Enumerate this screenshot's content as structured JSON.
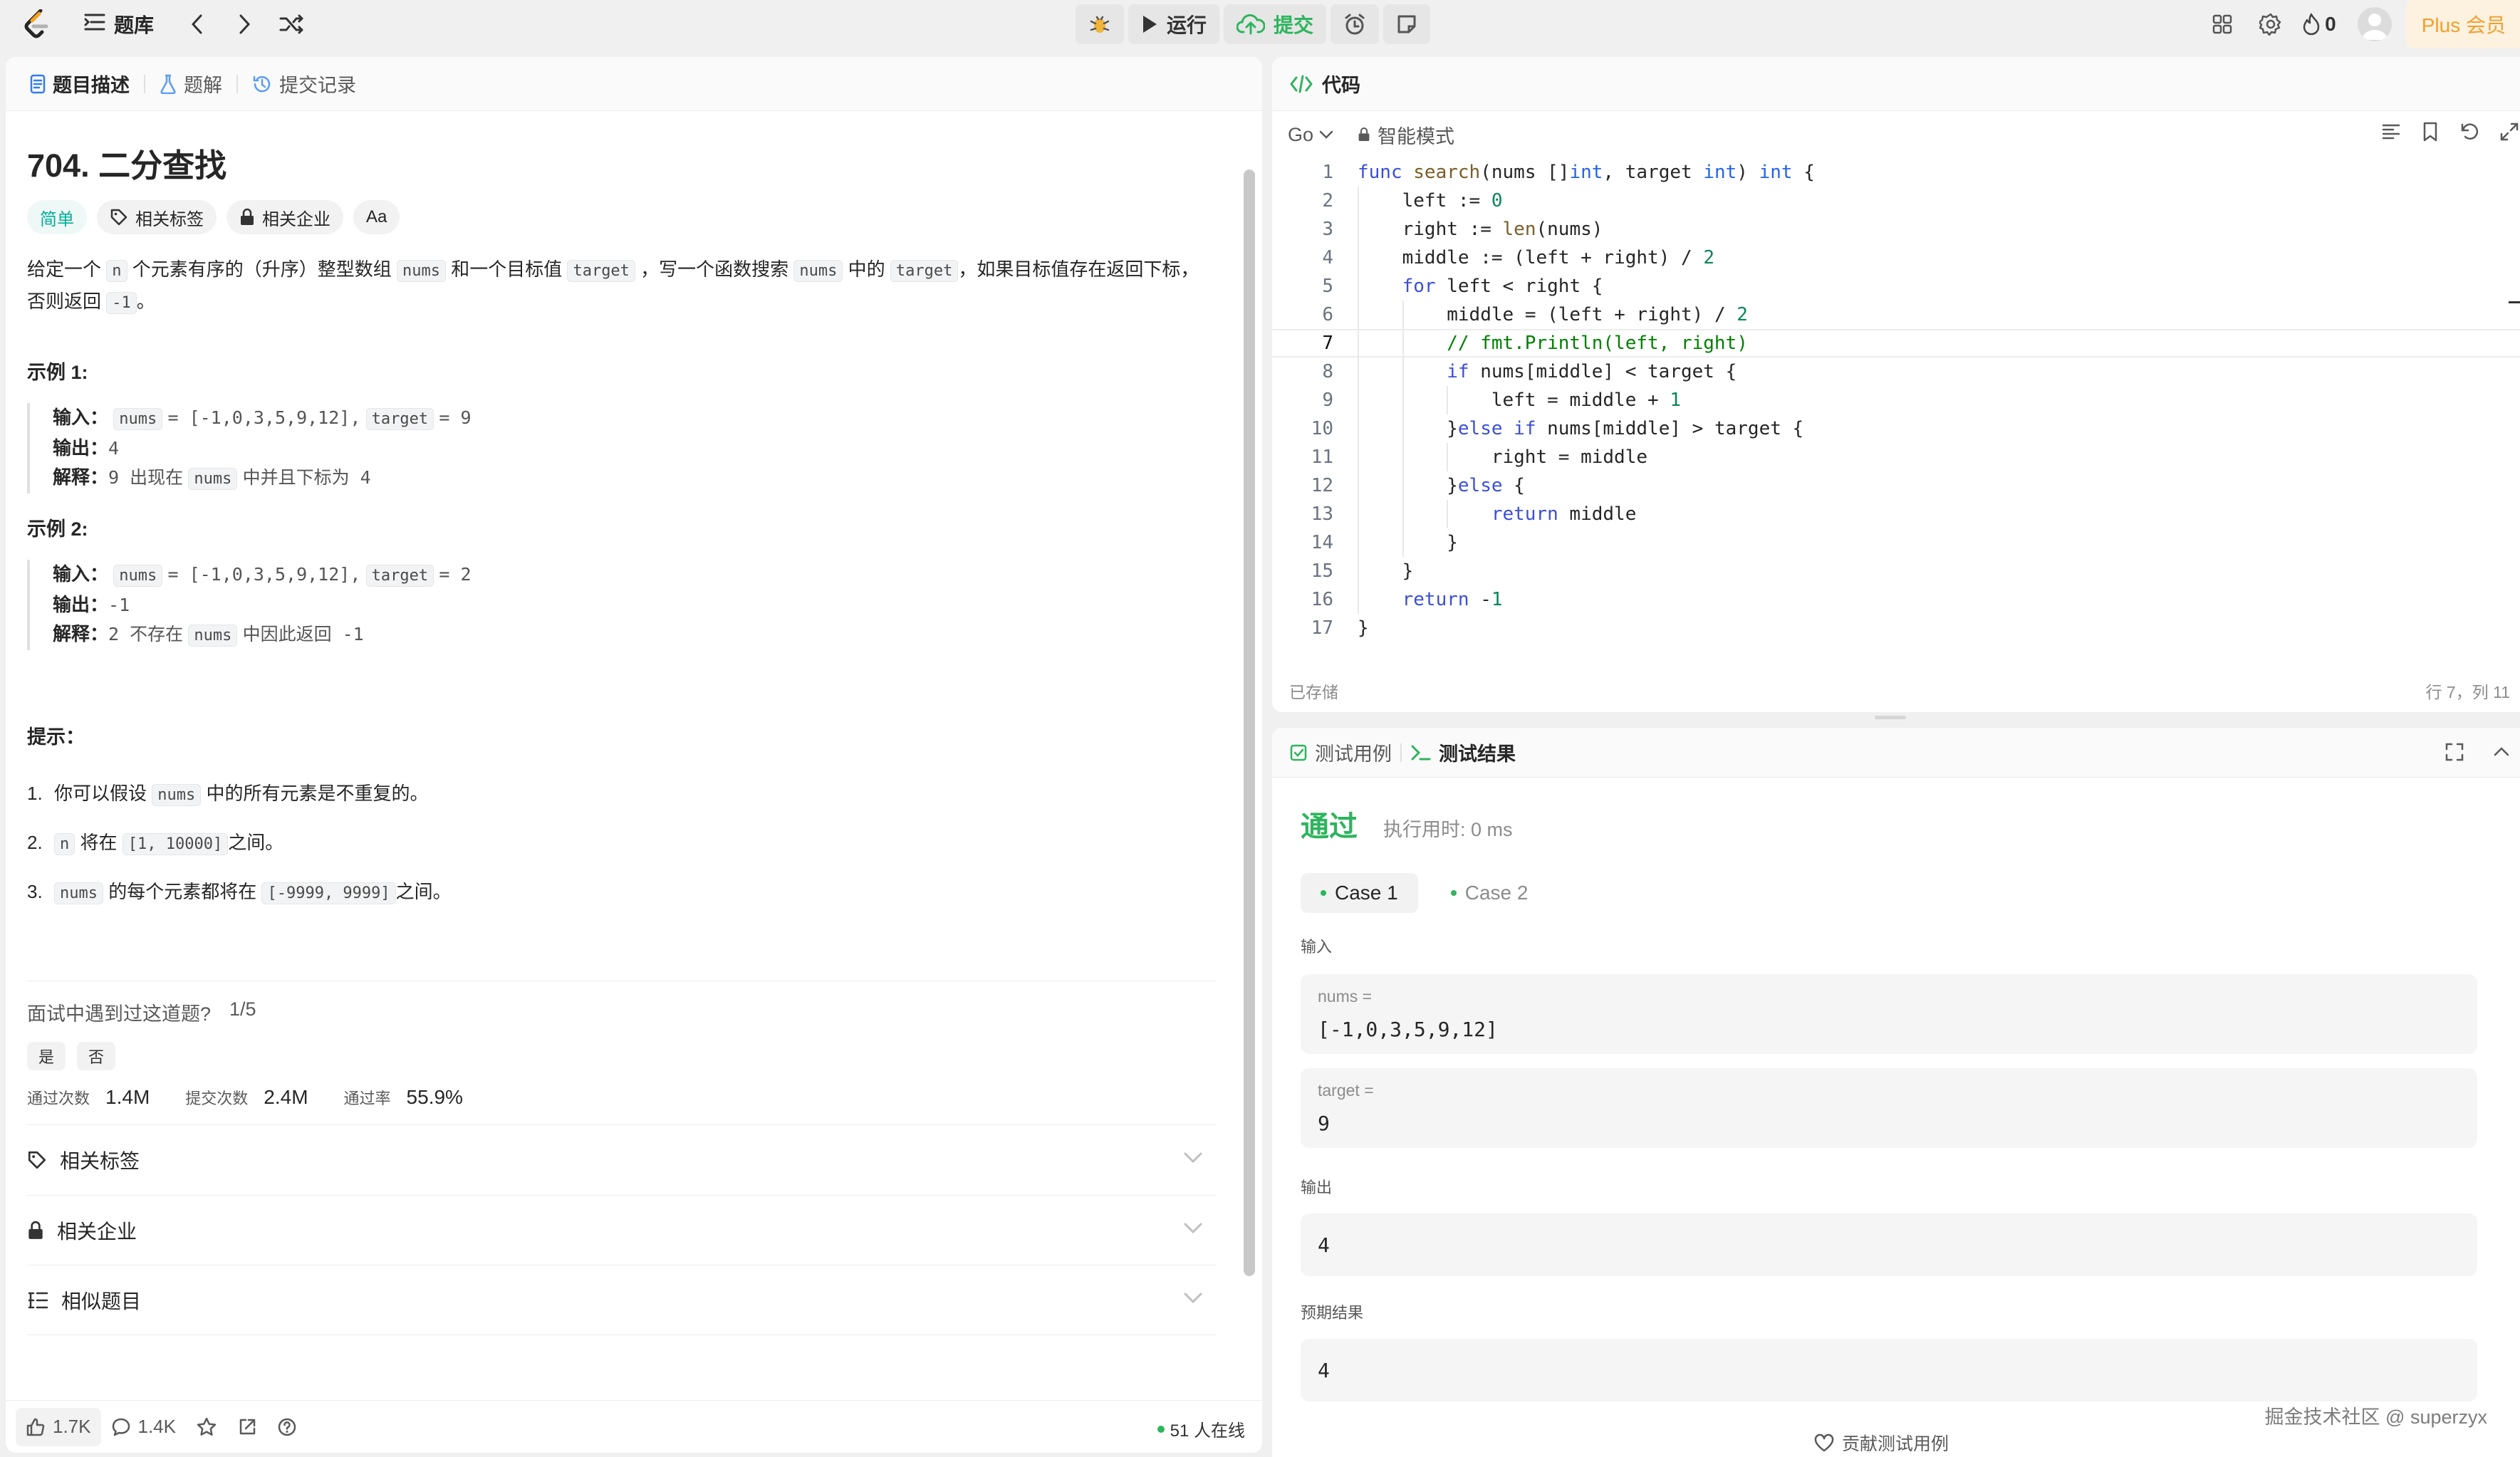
{
  "topbar": {
    "problem_list_label": "题库",
    "run_label": "运行",
    "submit_label": "提交",
    "fire_count": "0",
    "plus_label": "Plus 会员"
  },
  "left_tabs": [
    {
      "label": "题目描述",
      "icon": "description-icon"
    },
    {
      "label": "题解",
      "icon": "flask-icon"
    },
    {
      "label": "提交记录",
      "icon": "history-icon"
    }
  ],
  "problem": {
    "title": "704. 二分查找",
    "difficulty": "简单",
    "tags_label": "相关标签",
    "companies_label": "相关企业",
    "font_toggle": "Aa",
    "desc": {
      "p1": "给定一个",
      "c1": "n",
      "p2": "个元素有序的（升序）整型数组",
      "c2": "nums",
      "p3": "和一个目标值",
      "c3": "target",
      "p4": "，写一个函数搜索",
      "c4": "nums",
      "p5": "中的",
      "c5": "target",
      "p6": "，如果目标值存在返回下标，否则返回",
      "c6": "-1",
      "p7": "。"
    },
    "examples": [
      {
        "title": "示例 1:",
        "input_key": "输入：",
        "input_c1": "nums",
        "input_v1": "= [-1,0,3,5,9,12],",
        "input_c2": "target",
        "input_v2": "= 9",
        "output_key": "输出：",
        "output_val": "4",
        "explain_key": "解释：",
        "explain_a": "9 出现在",
        "explain_c": "nums",
        "explain_b": "中并且下标为 4"
      },
      {
        "title": "示例 2:",
        "input_key": "输入：",
        "input_c1": "nums",
        "input_v1": "= [-1,0,3,5,9,12],",
        "input_c2": "target",
        "input_v2": "= 2",
        "output_key": "输出：",
        "output_val": "-1",
        "explain_key": "解释：",
        "explain_a": "2 不存在",
        "explain_c": "nums",
        "explain_b": "中因此返回 -1"
      }
    ],
    "hints_title": "提示：",
    "hints": [
      {
        "num": "1.",
        "a": "你可以假设",
        "c": "nums",
        "b": "中的所有元素是不重复的。"
      },
      {
        "num": "2.",
        "a": "",
        "c": "n",
        "b": "将在",
        "c2": "[1, 10000]",
        "d": "之间。"
      },
      {
        "num": "3.",
        "a": "",
        "c": "nums",
        "b": "的每个元素都将在",
        "c2": "[-9999, 9999]",
        "d": "之间。"
      }
    ],
    "interview_question": "面试中遇到过这道题?",
    "interview_progress": "1/5",
    "yes": "是",
    "no": "否",
    "stats": {
      "accepted_label": "通过次数",
      "accepted_value": "1.4M",
      "submissions_label": "提交次数",
      "submissions_value": "2.4M",
      "rate_label": "通过率",
      "rate_value": "55.9%"
    },
    "accordions": [
      "相关标签",
      "相关企业",
      "相似题目"
    ]
  },
  "left_footer": {
    "likes": "1.7K",
    "comments": "1.4K",
    "online": "51 人在线"
  },
  "code_panel": {
    "title": "代码",
    "language": "Go",
    "mode": "智能模式",
    "status": "已存储",
    "cursor": "行 7，列 11",
    "active_line": 7,
    "lines": [
      "func search(nums []int, target int) int {",
      "    left := 0",
      "    right := len(nums)",
      "    middle := (left + right) / 2",
      "    for left < right {",
      "        middle = (left + right) / 2",
      "        // fmt.Println(left, right)",
      "        if nums[middle] < target {",
      "            left = middle + 1",
      "        }else if nums[middle] > target {",
      "            right = middle",
      "        }else {",
      "            return middle",
      "        }",
      "    }",
      "    return -1",
      "}"
    ]
  },
  "test_panel": {
    "tab_cases": "测试用例",
    "tab_results": "测试结果",
    "status": "通过",
    "runtime": "执行用时: 0 ms",
    "cases": [
      "Case 1",
      "Case 2"
    ],
    "input_label": "输入",
    "inputs": [
      {
        "name": "nums =",
        "value": "[-1,0,3,5,9,12]"
      },
      {
        "name": "target =",
        "value": "9"
      }
    ],
    "output_label": "输出",
    "output_value": "4",
    "expected_label": "预期结果",
    "expected_value": "4",
    "contribute": "贡献测试用例"
  },
  "watermark": "掘金技术社区 @ superzyx",
  "colors": {
    "accent_green": "#2db55d",
    "easy_teal": "#00af9b",
    "plus_orange": "#f0a02c"
  }
}
